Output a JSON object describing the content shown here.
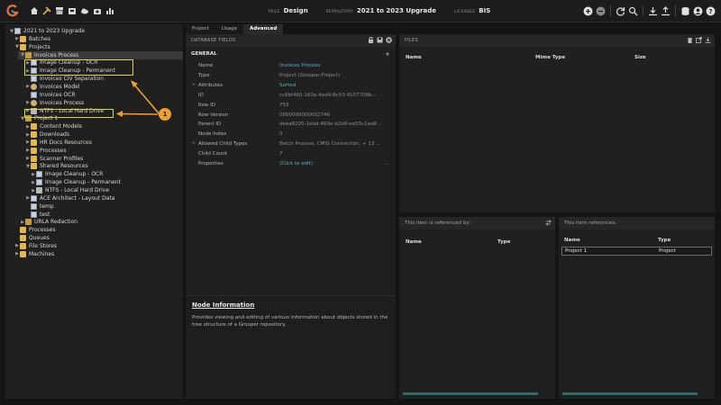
{
  "topbar": {
    "crumbs": [
      {
        "key": "PAGE",
        "value": "Design"
      },
      {
        "key": "REPOSITORY",
        "value": "2021 to 2023 Upgrade"
      },
      {
        "key": "LICENSEE",
        "value": "BIS"
      }
    ],
    "separator": "·"
  },
  "tree": {
    "items": [
      {
        "label": "2021 to 2023 Upgrade",
        "icon": "repository-icon",
        "caret": "▼"
      },
      {
        "label": "Batches",
        "icon": "folder-icon",
        "caret": "▶"
      },
      {
        "label": "Projects",
        "icon": "folder-icon",
        "caret": "▼"
      },
      {
        "label": "Invoices Process",
        "icon": "project-icon",
        "caret": "▼"
      },
      {
        "label": "Image Cleanup - OCR",
        "icon": "step-icon",
        "caret": "▶"
      },
      {
        "label": "Image Cleanup - Permanent",
        "icon": "step-icon",
        "caret": "▶"
      },
      {
        "label": "Invoices CIV Separation",
        "icon": "step-icon",
        "caret": ""
      },
      {
        "label": "Invoices Model",
        "icon": "gear-icon",
        "caret": "▶"
      },
      {
        "label": "Invoices OCR",
        "icon": "step-icon",
        "caret": ""
      },
      {
        "label": "Invoices Process",
        "icon": "gear-icon",
        "caret": "▶"
      },
      {
        "label": "NTFS - Local Hard Drive",
        "icon": "drive-icon",
        "caret": "▶"
      },
      {
        "label": "Project 1",
        "icon": "project-icon",
        "caret": "▼"
      },
      {
        "label": "Content Models",
        "icon": "folder-icon",
        "caret": "▶"
      },
      {
        "label": "Downloads",
        "icon": "folder-icon",
        "caret": "▶"
      },
      {
        "label": "HR Docs Resources",
        "icon": "folder-icon",
        "caret": "▶"
      },
      {
        "label": "Processes",
        "icon": "folder-icon",
        "caret": "▶"
      },
      {
        "label": "Scanner Profiles",
        "icon": "folder-icon",
        "caret": "▶"
      },
      {
        "label": "Shared Resources",
        "icon": "folder-icon",
        "caret": "▼"
      },
      {
        "label": "Image Cleanup - OCR",
        "icon": "step-icon",
        "caret": "▶"
      },
      {
        "label": "Image Cleanup - Permanent",
        "icon": "step-icon",
        "caret": "▶"
      },
      {
        "label": "NTFS - Local Hard Drive",
        "icon": "drive-icon",
        "caret": "▶"
      },
      {
        "label": "ACE Architect - Layout Data",
        "icon": "step-icon",
        "caret": "▶"
      },
      {
        "label": "temp",
        "icon": "step-icon",
        "caret": ""
      },
      {
        "label": "test",
        "icon": "step-icon",
        "caret": ""
      },
      {
        "label": "URLA Redaction",
        "icon": "project-icon",
        "caret": "▶"
      },
      {
        "label": "Processes",
        "icon": "folder-icon",
        "caret": ""
      },
      {
        "label": "Queues",
        "icon": "folder-icon",
        "caret": ""
      },
      {
        "label": "File Stores",
        "icon": "folder-icon",
        "caret": "▶"
      },
      {
        "label": "Machines",
        "icon": "folder-icon",
        "caret": "▶"
      }
    ],
    "callout_number": "1"
  },
  "tabs": [
    "Project",
    "Usage",
    "Advanced"
  ],
  "fields": {
    "header": "DATABASE FIELDS",
    "section": "GENERAL",
    "rows": [
      {
        "key": "Name",
        "value": "Invoices Process",
        "style": "link",
        "caret": ""
      },
      {
        "key": "Type",
        "value": "Project (Grooper.Project)",
        "style": "",
        "caret": ""
      },
      {
        "key": "Attributes",
        "value": "Sorted",
        "style": "link",
        "caret": ">"
      },
      {
        "key": "ID",
        "value": "cc8bf460-160e-4ed4-8c53-4157708b...",
        "style": "",
        "caret": ""
      },
      {
        "key": "Row ID",
        "value": "753",
        "style": "",
        "caret": ""
      },
      {
        "key": "Row Version",
        "value": "0000000000002746",
        "style": "",
        "caret": ""
      },
      {
        "key": "Parent ID",
        "value": "deea8220-1dad-469e-b2d8-ea55c1aa8...",
        "style": "",
        "caret": ""
      },
      {
        "key": "Node Index",
        "value": "0",
        "style": "",
        "caret": ""
      },
      {
        "key": "Allowed Child Types",
        "value": "Batch Process, CMIS Connection, + 13 ...",
        "style": "",
        "caret": ">"
      },
      {
        "key": "Child Count",
        "value": "7",
        "style": "",
        "caret": ""
      },
      {
        "key": "Properties",
        "value": "(Click to edit)",
        "style": "link",
        "caret": ""
      }
    ],
    "dots": "...",
    "node_info_title": "Node Information",
    "node_info_text": "Provides viewing and editing of various information about objects stored in the tree structure of a Grooper repository."
  },
  "files": {
    "header": "FILES",
    "columns": [
      "Name",
      "Mime Type",
      "Size"
    ]
  },
  "referenced_by": {
    "header": "This item is referenced by:",
    "columns": [
      "Name",
      "Type"
    ]
  },
  "references": {
    "header": "This item references:",
    "columns": [
      "Name",
      "Type"
    ],
    "rows": [
      {
        "name": "Project 1",
        "type": "Project"
      }
    ]
  },
  "colors": {
    "accent_link": "#4fb5c7",
    "highlight": "#d4d845",
    "callout": "#f0a030"
  }
}
